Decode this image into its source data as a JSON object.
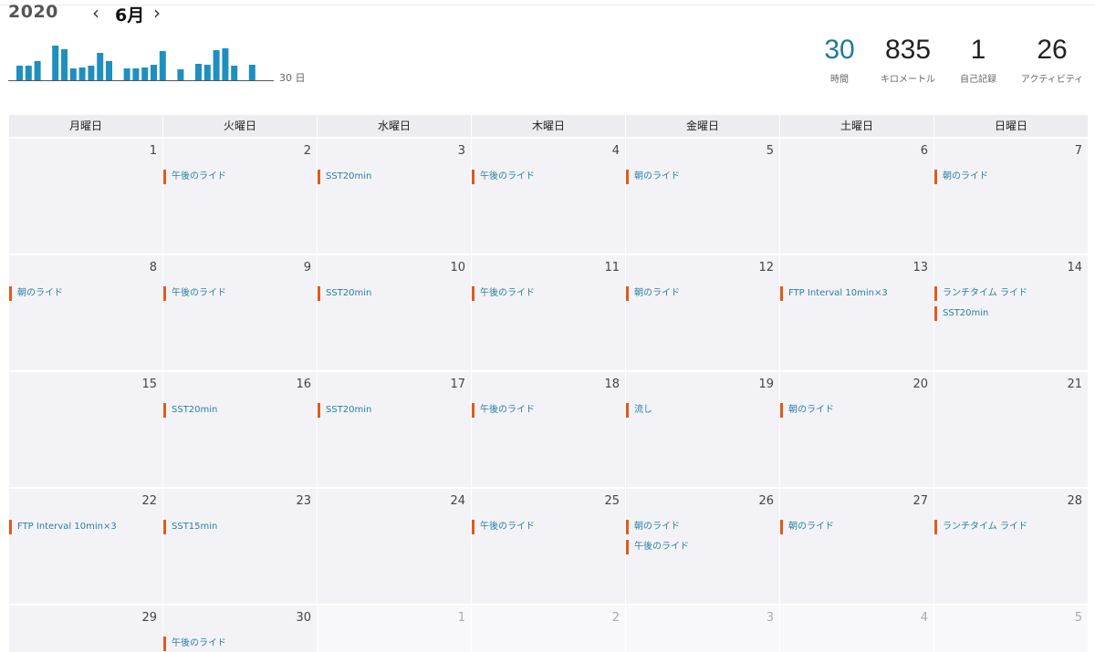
{
  "header": {
    "year": "2020",
    "month": "6月",
    "prev_icon": "‹",
    "next_icon": "›",
    "mini_chart_label": "30 日"
  },
  "stats": [
    {
      "value": "30",
      "label": "時間"
    },
    {
      "value": "835",
      "label": "キロメートル"
    },
    {
      "value": "1",
      "label": "自己記録"
    },
    {
      "value": "26",
      "label": "アクティビティ"
    }
  ],
  "colors": {
    "accent": "#1f7a9a",
    "event_bar": "#e05a1a",
    "event_text": "#2a7fa0",
    "mini_bar": "#1f8fc0"
  },
  "chart_data": {
    "type": "bar",
    "values": [
      16,
      16,
      21,
      0,
      38,
      34,
      13,
      14,
      16,
      30,
      21,
      0,
      13,
      13,
      14,
      17,
      32,
      0,
      12,
      0,
      18,
      17,
      33,
      35,
      16,
      0,
      17
    ]
  },
  "weekdays": [
    "月曜日",
    "火曜日",
    "水曜日",
    "木曜日",
    "金曜日",
    "土曜日",
    "日曜日"
  ],
  "weeks": [
    [
      {
        "day": "1",
        "events": []
      },
      {
        "day": "2",
        "events": [
          "午後のライド"
        ]
      },
      {
        "day": "3",
        "events": [
          "SST20min"
        ]
      },
      {
        "day": "4",
        "events": [
          "午後のライド"
        ]
      },
      {
        "day": "5",
        "events": [
          "朝のライド"
        ]
      },
      {
        "day": "6",
        "events": []
      },
      {
        "day": "7",
        "events": [
          "朝のライド"
        ]
      }
    ],
    [
      {
        "day": "8",
        "events": [
          "朝のライド"
        ]
      },
      {
        "day": "9",
        "events": [
          "午後のライド"
        ]
      },
      {
        "day": "10",
        "events": [
          "SST20min"
        ]
      },
      {
        "day": "11",
        "events": [
          "午後のライド"
        ]
      },
      {
        "day": "12",
        "events": [
          "朝のライド"
        ]
      },
      {
        "day": "13",
        "events": [
          "FTP Interval 10min×3"
        ]
      },
      {
        "day": "14",
        "events": [
          "ランチタイム ライド",
          "SST20min"
        ]
      }
    ],
    [
      {
        "day": "15",
        "events": []
      },
      {
        "day": "16",
        "events": [
          "SST20min"
        ]
      },
      {
        "day": "17",
        "events": [
          "SST20min"
        ]
      },
      {
        "day": "18",
        "events": [
          "午後のライド"
        ]
      },
      {
        "day": "19",
        "events": [
          "流し"
        ]
      },
      {
        "day": "20",
        "events": [
          "朝のライド"
        ]
      },
      {
        "day": "21",
        "events": []
      }
    ],
    [
      {
        "day": "22",
        "events": [
          "FTP Interval 10min×3"
        ]
      },
      {
        "day": "23",
        "events": [
          "SST15min"
        ]
      },
      {
        "day": "24",
        "events": []
      },
      {
        "day": "25",
        "events": [
          "午後のライド"
        ]
      },
      {
        "day": "26",
        "events": [
          "朝のライド",
          "午後のライド"
        ]
      },
      {
        "day": "27",
        "events": [
          "朝のライド"
        ]
      },
      {
        "day": "28",
        "events": [
          "ランチタイム ライド"
        ]
      }
    ],
    [
      {
        "day": "29",
        "events": []
      },
      {
        "day": "30",
        "events": [
          "午後のライド"
        ]
      },
      {
        "day": "1",
        "events": [],
        "other": true
      },
      {
        "day": "2",
        "events": [],
        "other": true
      },
      {
        "day": "3",
        "events": [],
        "other": true
      },
      {
        "day": "4",
        "events": [],
        "other": true
      },
      {
        "day": "5",
        "events": [],
        "other": true
      }
    ]
  ]
}
